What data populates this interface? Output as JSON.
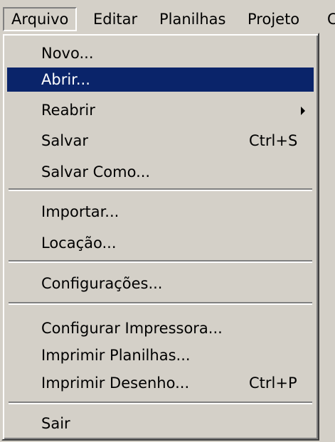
{
  "menubar": {
    "items": [
      {
        "label": "Arquivo"
      },
      {
        "label": "Editar"
      },
      {
        "label": "Planilhas"
      },
      {
        "label": "Projeto"
      },
      {
        "label": "C"
      }
    ]
  },
  "menu": {
    "items": [
      {
        "label": "Novo...",
        "shortcut": ""
      },
      {
        "label": "Abrir...",
        "shortcut": ""
      },
      {
        "label": "Reabrir",
        "shortcut": ""
      },
      {
        "label": "Salvar",
        "shortcut": "Ctrl+S"
      },
      {
        "label": "Salvar Como...",
        "shortcut": ""
      },
      {
        "label": "Importar...",
        "shortcut": ""
      },
      {
        "label": "Locação...",
        "shortcut": ""
      },
      {
        "label": "Configurações...",
        "shortcut": ""
      },
      {
        "label": "Configurar Impressora...",
        "shortcut": ""
      },
      {
        "label": "Imprimir Planilhas...",
        "shortcut": ""
      },
      {
        "label": "Imprimir Desenho...",
        "shortcut": "Ctrl+P"
      },
      {
        "label": "Sair",
        "shortcut": ""
      }
    ],
    "highlight_color": "#0a246a",
    "submenu_arrow_icon": "chevron-right-icon"
  }
}
